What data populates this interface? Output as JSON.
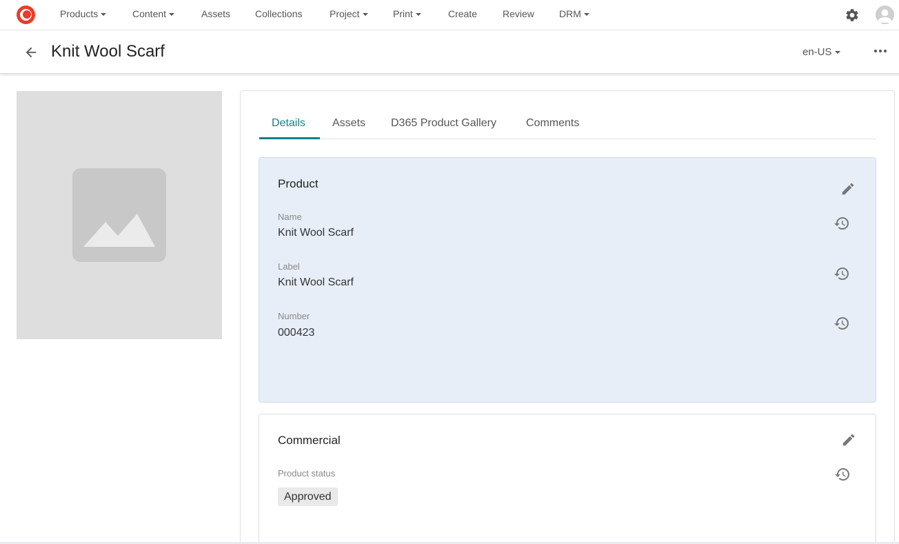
{
  "nav": {
    "items": [
      {
        "label": "Products",
        "dropdown": true
      },
      {
        "label": "Content",
        "dropdown": true
      },
      {
        "label": "Assets",
        "dropdown": false
      },
      {
        "label": "Collections",
        "dropdown": false
      },
      {
        "label": "Project",
        "dropdown": true
      },
      {
        "label": "Print",
        "dropdown": true
      },
      {
        "label": "Create",
        "dropdown": false
      },
      {
        "label": "Review",
        "dropdown": false
      },
      {
        "label": "DRM",
        "dropdown": true
      }
    ]
  },
  "header": {
    "title": "Knit Wool Scarf",
    "locale": "en-US"
  },
  "tabs": [
    {
      "label": "Details",
      "active": true
    },
    {
      "label": "Assets",
      "active": false
    },
    {
      "label": "D365 Product Gallery",
      "active": false
    },
    {
      "label": "Comments",
      "active": false
    }
  ],
  "product_section": {
    "title": "Product",
    "fields": [
      {
        "label": "Name",
        "value": "Knit Wool Scarf"
      },
      {
        "label": "Label",
        "value": "Knit Wool Scarf"
      },
      {
        "label": "Number",
        "value": "000423"
      }
    ]
  },
  "commercial_section": {
    "title": "Commercial",
    "fields": [
      {
        "label": "Product status",
        "value": "Approved"
      }
    ]
  },
  "icons": {
    "logo": "brand-logo",
    "settings": "gear-icon",
    "user": "avatar-icon",
    "back": "back-arrow-icon",
    "more": "more-horizontal-icon",
    "placeholder": "image-placeholder-icon",
    "edit": "pencil-icon",
    "history": "history-icon"
  },
  "colors": {
    "accent": "#127f8a",
    "logo": "#eb3b2a",
    "product_card_bg": "#e8eef8"
  }
}
